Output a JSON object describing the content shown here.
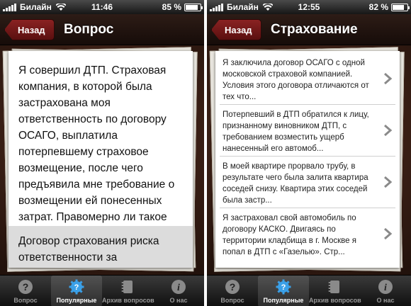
{
  "left": {
    "status": {
      "carrier": "Билайн",
      "time": "11:46",
      "battery": "85 %",
      "battery_level": 0.85
    },
    "nav": {
      "back": "Назад",
      "title": "Вопрос"
    },
    "question": "Я совершил ДТП. Страховая компания, в которой была застрахована моя ответственность по договору ОСАГО, выплатила потерпевшему страховое возмещение, после чего предъявила мне требование о возмещении ей понесенных затрат. Правомерно ли такое требование?",
    "answer": "Договор страхования риска ответственности за"
  },
  "right": {
    "status": {
      "carrier": "Билайн",
      "time": "12:55",
      "battery": "82 %",
      "battery_level": 0.82
    },
    "nav": {
      "back": "Назад",
      "title": "Страхование"
    },
    "items": [
      "Я заключила договор ОСАГО с одной московской страховой компанией. Условия этого договора отличаются от тех что...",
      "Потерпевший в ДТП обратился к лицу, признанному виновником ДТП, с требованием возместить ущерб нанесенный его автомоб...",
      "В моей квартире прорвало трубу, в результате чего была залита квартира соседей снизу. Квартира этих соседей была застр...",
      "Я застраховал свой автомобиль по договору КАСКО. Двигаясь по территории кладбища в г. Москве я попал в ДТП с «Газелью». Стр..."
    ]
  },
  "tabs": [
    {
      "label": "Вопрос",
      "icon": "question-icon"
    },
    {
      "label": "Популярные",
      "icon": "gear-question-icon",
      "active": true
    },
    {
      "label": "Архив вопросов",
      "icon": "archive-icon"
    },
    {
      "label": "О нас",
      "icon": "info-icon"
    }
  ]
}
